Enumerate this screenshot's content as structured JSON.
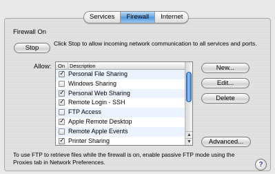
{
  "tabs": [
    {
      "label": "Services",
      "active": false
    },
    {
      "label": "Firewall",
      "active": true
    },
    {
      "label": "Internet",
      "active": false
    }
  ],
  "firewall": {
    "status": "Firewall On",
    "stop_label": "Stop",
    "stop_description": "Click Stop to allow incoming network communication to all services and ports."
  },
  "allow": {
    "label": "Allow:",
    "columns": {
      "on": "On",
      "description": "Description"
    },
    "rows": [
      {
        "label": "Personal File Sharing",
        "checked": true
      },
      {
        "label": "Windows Sharing",
        "checked": false
      },
      {
        "label": "Personal Web Sharing",
        "checked": true
      },
      {
        "label": "Remote Login - SSH",
        "checked": true
      },
      {
        "label": "FTP Access",
        "checked": false
      },
      {
        "label": "Apple Remote Desktop",
        "checked": true
      },
      {
        "label": "Remote Apple Events",
        "checked": false
      },
      {
        "label": "Printer Sharing",
        "checked": true
      }
    ]
  },
  "buttons": {
    "new": "New...",
    "edit": "Edit...",
    "delete": "Delete",
    "advanced": "Advanced..."
  },
  "footer": {
    "note": "To use FTP to retrieve files while the firewall is on, enable passive FTP mode using the Proxies tab in Network Preferences."
  },
  "help": {
    "label": "?"
  },
  "icons": {
    "checkbox_checked": "checkmark-icon",
    "scroll_up": "arrow-up-icon",
    "scroll_down": "arrow-down-icon",
    "help": "help-icon"
  },
  "colors": {
    "accent": "#5fa5e6",
    "scroll_thumb": "#3b7fd4"
  }
}
